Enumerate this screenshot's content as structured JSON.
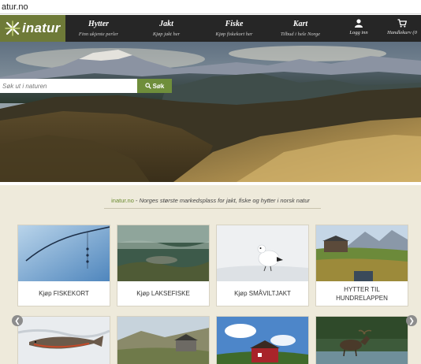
{
  "browser": {
    "url": "atur.no"
  },
  "nav": {
    "logo_text": "inatur",
    "items": [
      {
        "title": "Hytter",
        "subtitle": "Finn ukjente perler"
      },
      {
        "title": "Jakt",
        "subtitle": "Kjøp jakt her"
      },
      {
        "title": "Fiske",
        "subtitle": "Kjøp fiskekort her"
      },
      {
        "title": "Kart",
        "subtitle": "Tilbud i hele Norge"
      }
    ],
    "login_label": "Logg inn",
    "login_icon": "user-icon",
    "cart_label": "Handlekurv (0",
    "cart_icon": "cart-icon",
    "colors": {
      "bar": "#262626",
      "logo_bg": "#6e7a38"
    }
  },
  "search": {
    "placeholder": "Søk ut i naturen",
    "button_label": "Søk",
    "button_icon": "magnifier-icon",
    "button_color": "#6f8e3b"
  },
  "main": {
    "tagline_brand": "inatur.no",
    "tagline_separator": " - ",
    "tagline_text": "Norges største markedsplass for jakt, fiske og hytter i norsk natur",
    "cards": [
      {
        "label": "Kjøp FISKEKORT",
        "image": "fishing-rod-photo"
      },
      {
        "label": "Kjøp LAKSEFISKE",
        "image": "underwater-salmon-photo"
      },
      {
        "label": "Kjøp SMÅVILTJAKT",
        "image": "ptarmigan-snow-photo"
      },
      {
        "label": "HYTTER TIL",
        "label_line2": "HUNDRELAPPEN",
        "image": "mountain-cabin-photo"
      },
      {
        "label": "",
        "image": "trout-on-snow-photo"
      },
      {
        "label": "",
        "image": "stone-cabin-photo"
      },
      {
        "label": "",
        "image": "red-cabin-photo"
      },
      {
        "label": "",
        "image": "moose-in-water-photo"
      }
    ],
    "prev_icon": "chevron-left-icon",
    "next_icon": "chevron-right-icon",
    "colors": {
      "content_bg": "#eeeadb",
      "brand_green": "#6a8a2e"
    }
  }
}
